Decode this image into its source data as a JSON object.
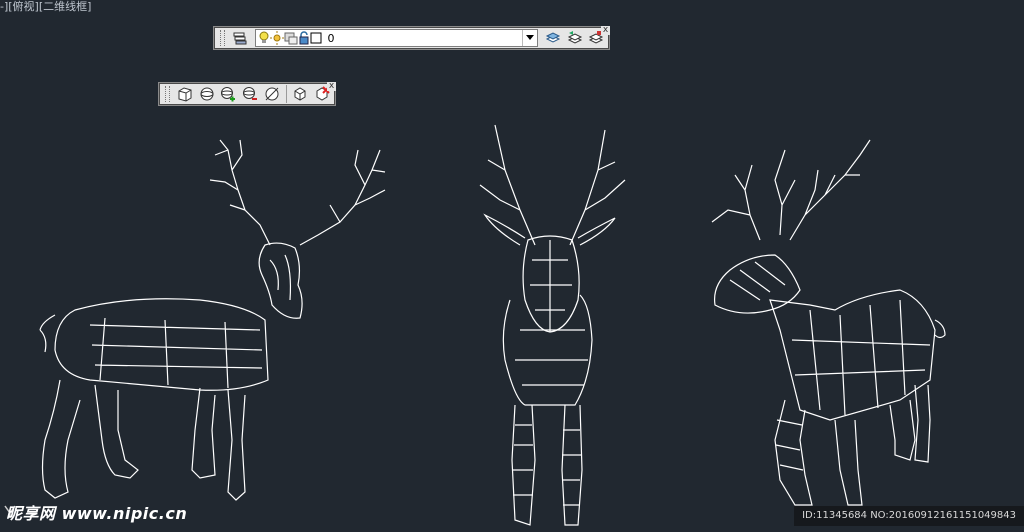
{
  "viewport": {
    "label": "-][俯视][二维线框]"
  },
  "layer_toolbar": {
    "current_layer": "0",
    "close_glyph": "x",
    "icons": [
      "layer-properties-icon",
      "lightbulb-icon",
      "sun-icon",
      "lock-icon",
      "color-swatch-icon",
      "dropdown-arrow-icon",
      "make-current-icon",
      "layer-previous-icon",
      "layer-state-icon"
    ]
  },
  "view_toolbar": {
    "close_glyph": "x",
    "icons": [
      "box-view-icon",
      "sphere-icon",
      "sphere-add-icon",
      "sphere-remove-icon",
      "sphere-cut-icon",
      "cube-icon",
      "delete-cube-icon"
    ]
  },
  "watermarks": {
    "left": "昵享网 www.nipic.cn",
    "right": "ID:11345684 NO:20160912161151049843"
  },
  "colors": {
    "background": "#212830",
    "linework": "#ffffff",
    "toolbar_bg": "#e6e6e6"
  }
}
